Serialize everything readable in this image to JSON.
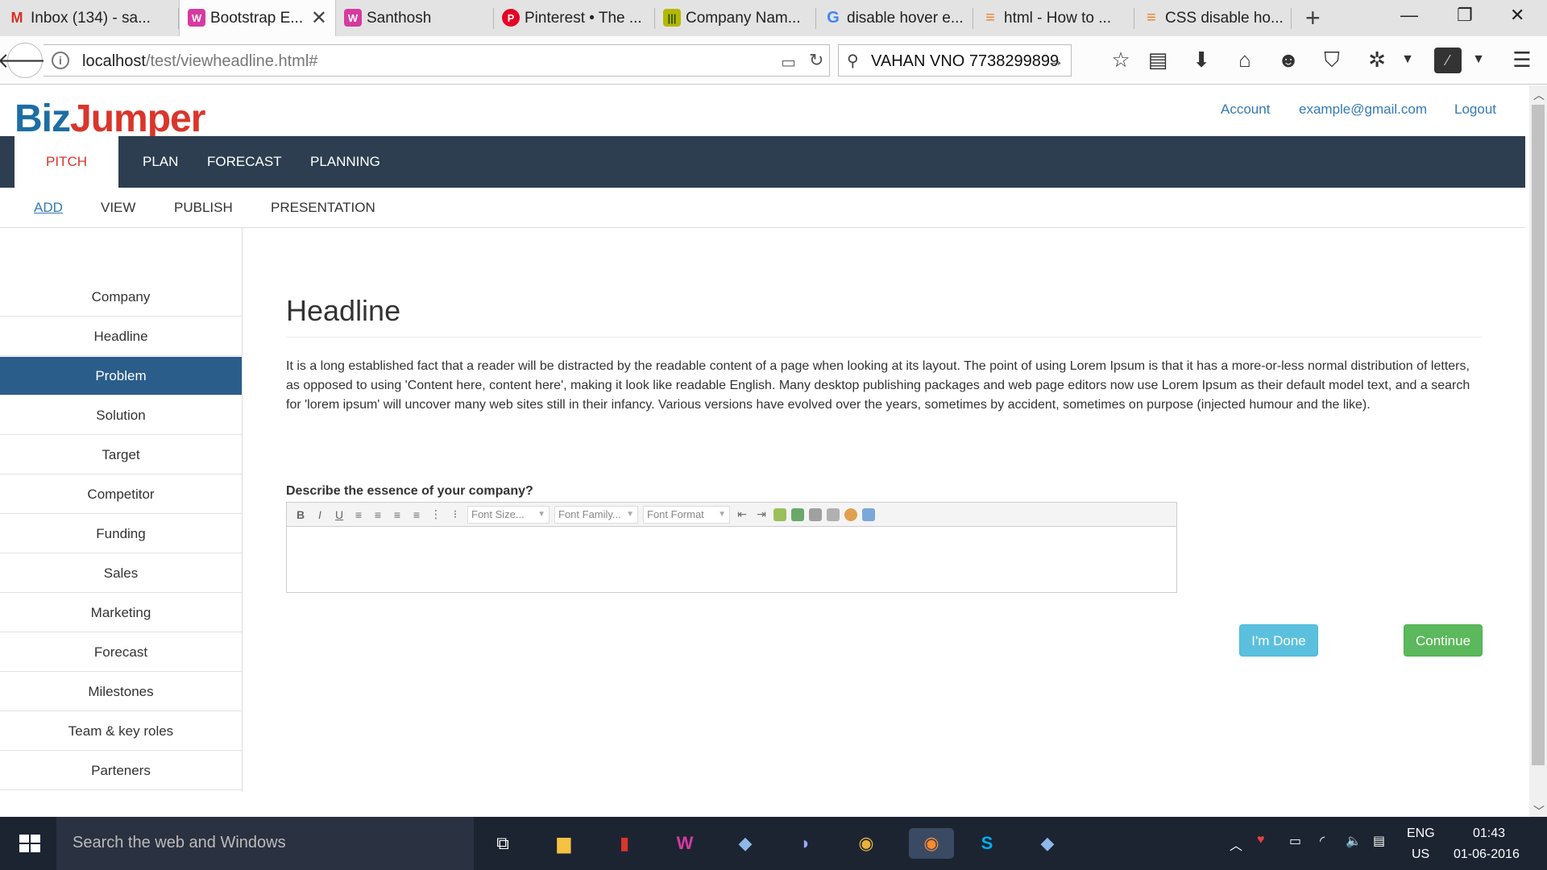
{
  "browser": {
    "tabs": [
      {
        "title": "Inbox (134) - sa...",
        "favicon": "M",
        "favicon_color": "#d93025"
      },
      {
        "title": "Bootstrap E...",
        "favicon": "W",
        "favicon_color": "#d63aa0",
        "active": true
      },
      {
        "title": "Santhosh",
        "favicon": "W",
        "favicon_color": "#d63aa0"
      },
      {
        "title": "Pinterest • The ...",
        "favicon": "P",
        "favicon_color": "#e60023"
      },
      {
        "title": "Company Nam...",
        "favicon": "|||",
        "favicon_color": "#b5b800"
      },
      {
        "title": "disable hover e...",
        "favicon": "G",
        "favicon_color": "#4285f4"
      },
      {
        "title": "html - How to ...",
        "favicon": "≡",
        "favicon_color": "#f48024"
      },
      {
        "title": "CSS disable ho...",
        "favicon": "≡",
        "favicon_color": "#f48024"
      }
    ],
    "url_host": "localhost",
    "url_path": "/test/viewheadline.html#",
    "search_value": "VAHAN VNO 7738299899"
  },
  "site": {
    "logo_part1": "Biz",
    "logo_part2": "Jumper",
    "account_link": "Account",
    "email_link": "example@gmail.com",
    "logout_link": "Logout"
  },
  "main_nav": [
    "PITCH",
    "PLAN",
    "FORECAST",
    "PLANNING"
  ],
  "sub_nav": [
    "ADD",
    "VIEW",
    "PUBLISH",
    "PRESENTATION"
  ],
  "sidebar": [
    "Company",
    "Headline",
    "Problem",
    "Solution",
    "Target",
    "Competitor",
    "Funding",
    "Sales",
    "Marketing",
    "Forecast",
    "Milestones",
    "Team & key roles",
    "Parteners"
  ],
  "content": {
    "title": "Headline",
    "paragraph": "It is a long established fact that a reader will be distracted by the readable content of a page when looking at its layout. The point of using Lorem Ipsum is that it has a more-or-less normal distribution of letters, as opposed to using 'Content here, content here', making it look like readable English. Many desktop publishing packages and web page editors now use Lorem Ipsum as their default model text, and a search for 'lorem ipsum' will uncover many web sites still in their infancy. Various versions have evolved over the years, sometimes by accident, sometimes on purpose (injected humour and the like).",
    "question": "Describe the essence of your company?",
    "editor": {
      "font_size": "Font Size...",
      "font_family": "Font Family...",
      "font_format": "Font Format"
    },
    "done_button": "I'm Done",
    "continue_button": "Continue"
  },
  "taskbar": {
    "search_placeholder": "Search the web and Windows",
    "language": "ENG",
    "region": "US",
    "time": "01:43",
    "date": "01-06-2016"
  }
}
